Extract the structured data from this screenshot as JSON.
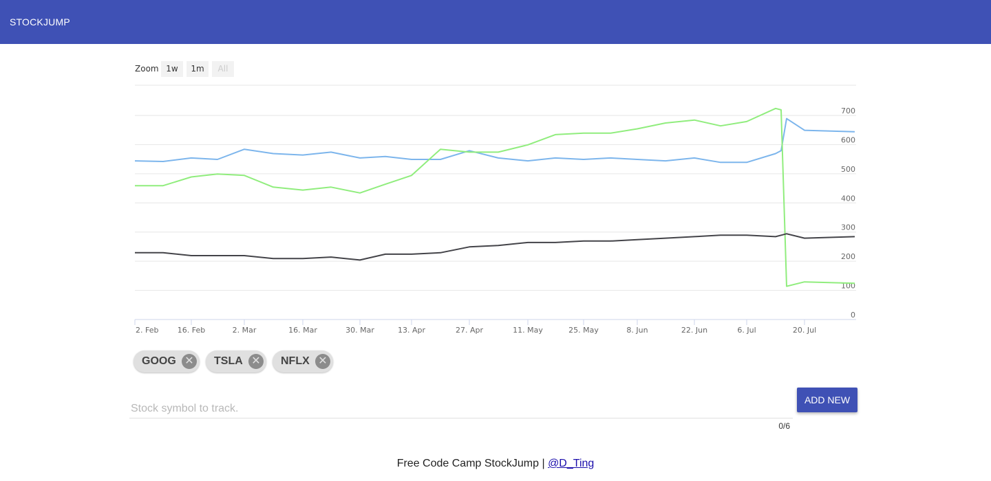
{
  "app": {
    "title": "STOCKJUMP"
  },
  "zoom": {
    "label": "Zoom",
    "buttons": [
      "1w",
      "1m",
      "All"
    ],
    "selected": "All"
  },
  "chips": [
    {
      "symbol": "GOOG",
      "remove_glyph": "✕",
      "remove_icon": "close-circle-icon"
    },
    {
      "symbol": "TSLA",
      "remove_glyph": "✕",
      "remove_icon": "close-circle-icon"
    },
    {
      "symbol": "NFLX",
      "remove_glyph": "✕",
      "remove_icon": "close-circle-icon"
    }
  ],
  "input": {
    "placeholder": "Stock symbol to track.",
    "value": "",
    "counter": "0/6"
  },
  "add_button": {
    "label": "ADD NEW"
  },
  "footer": {
    "text": "Free Code Camp StockJump | ",
    "link_text": "@D_Ting"
  },
  "colors": {
    "primary": "#3f51b5",
    "series_colors": [
      "#7cb5ec",
      "#90ed7d",
      "#434348"
    ]
  },
  "chart_data": {
    "type": "line",
    "title": "",
    "xlabel": "",
    "ylabel": "",
    "ylim": [
      0,
      700
    ],
    "y_ticks": [
      "0",
      "100",
      "200",
      "300",
      "400",
      "500",
      "600",
      "700"
    ],
    "x_ticks": [
      "2. Feb",
      "16. Feb",
      "2. Mar",
      "16. Mar",
      "30. Mar",
      "13. Apr",
      "27. Apr",
      "11. May",
      "25. May",
      "8. Jun",
      "22. Jun",
      "6. Jul",
      "20. Jul"
    ],
    "grid": true,
    "legend": "none",
    "x": [
      "2. Feb",
      "9. Feb",
      "16. Feb",
      "23. Feb",
      "2. Mar",
      "9. Mar",
      "16. Mar",
      "23. Mar",
      "30. Mar",
      "6. Apr",
      "13. Apr",
      "20. Apr",
      "27. Apr",
      "4. May",
      "11. May",
      "18. May",
      "25. May",
      "1. Jun",
      "8. Jun",
      "15. Jun",
      "22. Jun",
      "29. Jun",
      "6. Jul",
      "13. Jul",
      "16. Jul",
      "17. Jul",
      "20. Jul",
      "27. Jul"
    ],
    "series": [
      {
        "color": "#7cb5ec",
        "values": [
          530,
          528,
          540,
          535,
          570,
          555,
          550,
          560,
          540,
          545,
          535,
          535,
          565,
          540,
          530,
          540,
          535,
          540,
          535,
          530,
          540,
          525,
          525,
          555,
          565,
          675,
          635,
          630
        ]
      },
      {
        "color": "#90ed7d",
        "values": [
          445,
          445,
          475,
          485,
          480,
          440,
          430,
          440,
          420,
          450,
          480,
          570,
          560,
          560,
          585,
          620,
          625,
          625,
          640,
          660,
          670,
          650,
          665,
          710,
          705,
          100,
          115,
          110
        ]
      },
      {
        "color": "#434348",
        "values": [
          215,
          215,
          205,
          205,
          205,
          195,
          195,
          200,
          190,
          210,
          210,
          215,
          235,
          240,
          250,
          250,
          255,
          255,
          260,
          265,
          270,
          275,
          275,
          270,
          275,
          280,
          265,
          270
        ]
      }
    ]
  }
}
